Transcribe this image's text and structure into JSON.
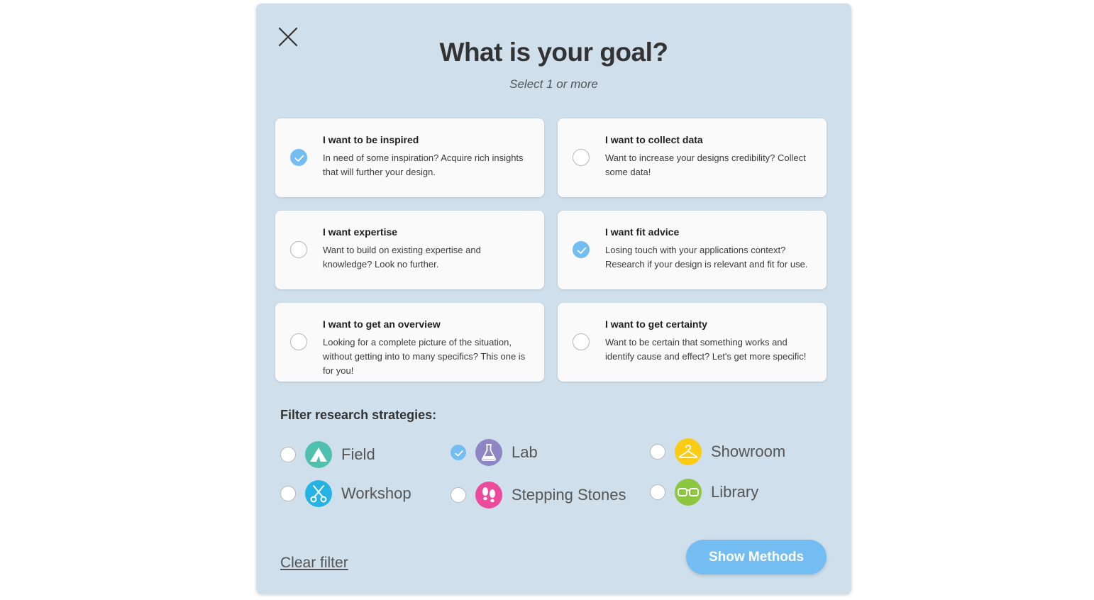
{
  "modal": {
    "title": "What is your goal?",
    "subtitle": "Select 1 or more"
  },
  "goals": [
    {
      "title": "I want to be inspired",
      "description": "In need of some inspiration? Acquire rich insights that will further your design.",
      "checked": true
    },
    {
      "title": "I want to collect data",
      "description": "Want to increase your designs credibility? Collect some data!",
      "checked": false
    },
    {
      "title": "I want expertise",
      "description": "Want to build on existing expertise and knowledge? Look no further.",
      "checked": false
    },
    {
      "title": "I want fit advice",
      "description": "Losing touch with your applications context? Research if your design is relevant and fit for use.",
      "checked": true
    },
    {
      "title": "I want to get an overview",
      "description": "Looking for a complete picture of the situation, without getting into to many specifics? This one is for you!",
      "checked": false
    },
    {
      "title": "I want to get certainty",
      "description": "Want to be certain that something works and identify cause and effect? Let's get more specific!",
      "checked": false
    }
  ],
  "filter": {
    "label": "Filter research strategies:",
    "strategies": [
      {
        "label": "Field",
        "icon": "tent-icon",
        "color": "#4fbfae",
        "checked": false
      },
      {
        "label": "Lab",
        "icon": "flask-icon",
        "color": "#8e85c4",
        "checked": true
      },
      {
        "label": "Showroom",
        "icon": "hanger-icon",
        "color": "#fccb14",
        "checked": false
      },
      {
        "label": "Workshop",
        "icon": "scissors-icon",
        "color": "#25b2e4",
        "checked": false
      },
      {
        "label": "Stepping Stones",
        "icon": "footprints-icon",
        "color": "#ec4a9c",
        "checked": false
      },
      {
        "label": "Library",
        "icon": "glasses-icon",
        "color": "#8dc63f",
        "checked": false
      }
    ]
  },
  "actions": {
    "clear_filter": "Clear filter",
    "show_methods": "Show Methods"
  },
  "colors": {
    "accent": "#74bdf2",
    "modal_bg": "#cfdfec",
    "card_bg": "#fafafa"
  }
}
